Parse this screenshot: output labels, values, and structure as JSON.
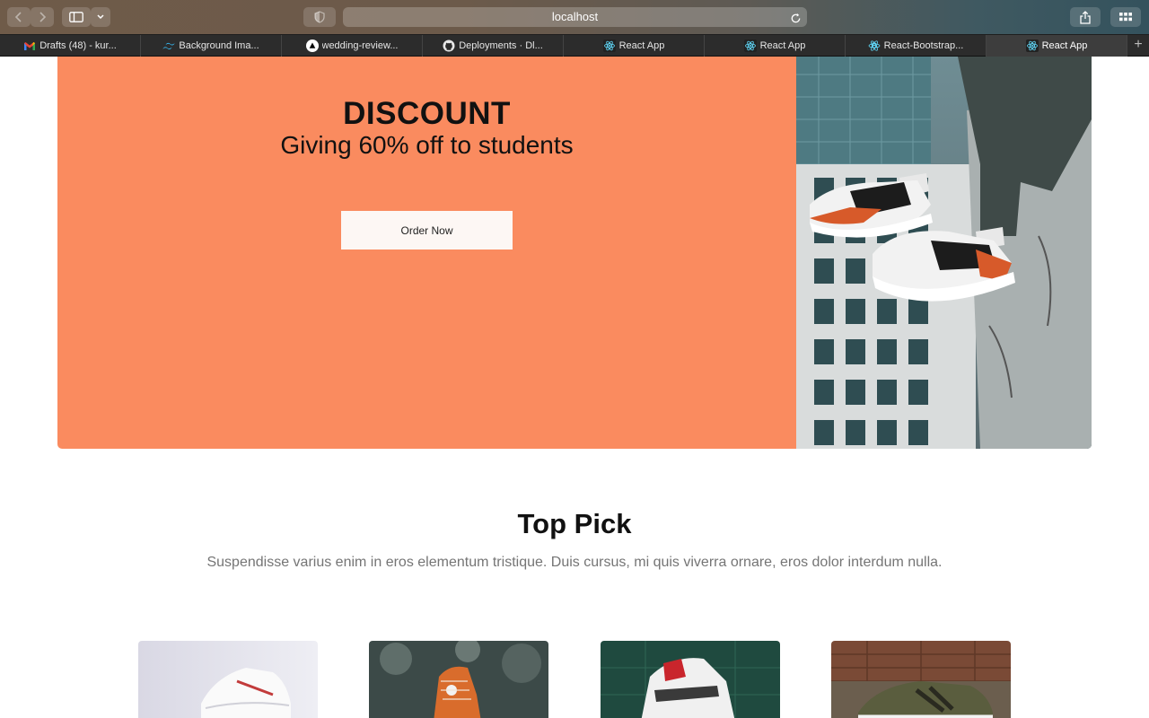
{
  "browser": {
    "url": "localhost",
    "tabs": [
      {
        "label": "Drafts (48) - kur...",
        "icon": "gmail-icon"
      },
      {
        "label": "Background Ima...",
        "icon": "tailwind-icon"
      },
      {
        "label": "wedding-review...",
        "icon": "vercel-icon"
      },
      {
        "label": "Deployments · Dl...",
        "icon": "github-icon"
      },
      {
        "label": "React App",
        "icon": "react-icon"
      },
      {
        "label": "React App",
        "icon": "react-icon"
      },
      {
        "label": "React-Bootstrap...",
        "icon": "react-bootstrap-icon"
      },
      {
        "label": "React App",
        "icon": "react-icon",
        "active": true
      }
    ]
  },
  "hero": {
    "title": "DISCOUNT",
    "subtitle": "Giving 60% off to students",
    "button": "Order Now",
    "background_color": "#fa8b5f"
  },
  "top_pick": {
    "title": "Top Pick",
    "description": "Suspendisse varius enim in eros elementum tristique. Duis cursus, mi quis viverra ornare, eros dolor interdum nulla.",
    "products": [
      {
        "image": "white-sneaker-photo"
      },
      {
        "image": "orange-high-top-photo"
      },
      {
        "image": "red-white-sneaker-photo"
      },
      {
        "image": "olive-new-balance-photo"
      }
    ]
  }
}
